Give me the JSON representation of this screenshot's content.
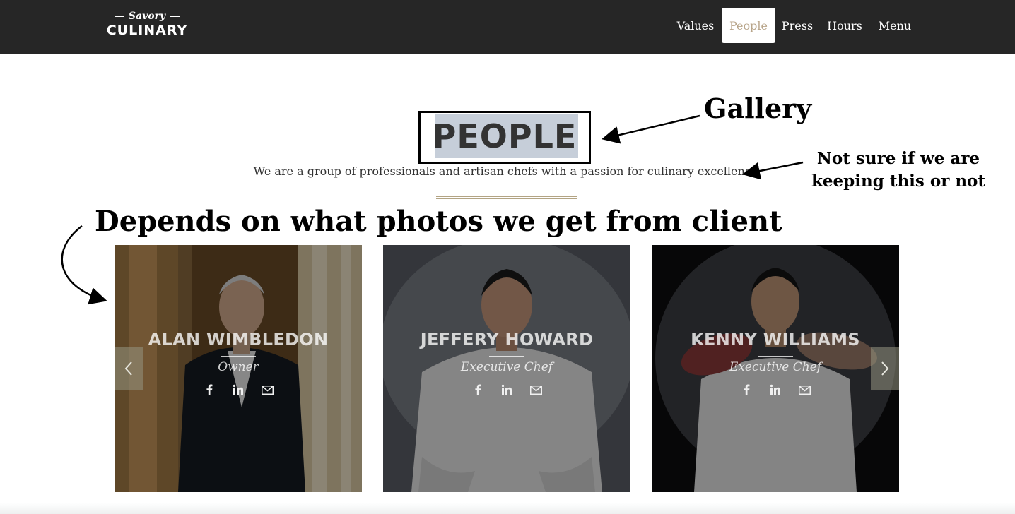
{
  "header": {
    "logo_script": "Savory",
    "logo_word": "CULINARY",
    "nav": [
      "Values",
      "People",
      "Press",
      "Hours",
      "Menu"
    ],
    "active_nav": "People"
  },
  "section": {
    "title": "PEOPLE",
    "subtitle": "We are a group of professionals and artisan chefs with a passion for culinary excellence."
  },
  "annotations": {
    "gallery": "Gallery",
    "not_sure_line1": "Not sure if we are",
    "not_sure_line2": "keeping this or not",
    "depends": "Depends on what photos we get from client"
  },
  "people": [
    {
      "name": "ALAN WIMBLEDON",
      "role": "Owner"
    },
    {
      "name": "JEFFERY HOWARD",
      "role": "Executive Chef"
    },
    {
      "name": "KENNY WILLIAMS",
      "role": "Executive Chef"
    }
  ],
  "icons": [
    "facebook-icon",
    "linkedin-icon",
    "mail-icon",
    "chevron-left-icon",
    "chevron-right-icon"
  ],
  "colors": {
    "header_bg": "#262626",
    "accent": "#b8a58a",
    "highlight": "#c6ced9",
    "divider": "#b3a484"
  }
}
